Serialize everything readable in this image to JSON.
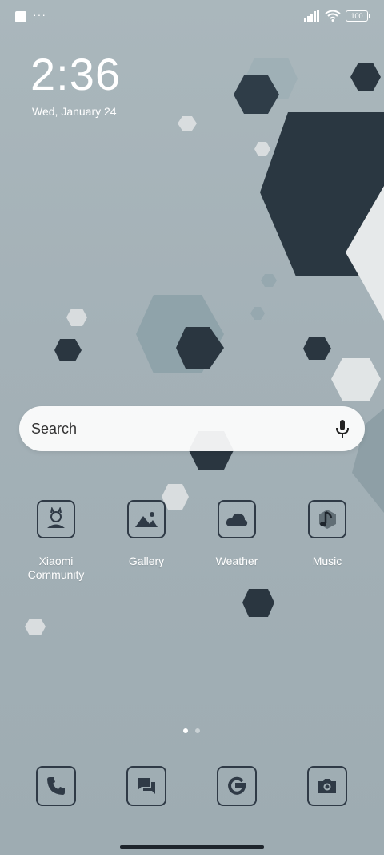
{
  "status_bar": {
    "notification_dots": "···",
    "battery_level": "100",
    "icons": [
      "app-notification-icon",
      "signal-icon",
      "wifi-icon",
      "battery-icon"
    ]
  },
  "clock": {
    "time": "2:36",
    "date": "Wed, January 24"
  },
  "search": {
    "placeholder": "Search",
    "icon": "mic-icon"
  },
  "apps": [
    {
      "label": "Xiaomi Community",
      "icon": "community-icon"
    },
    {
      "label": "Gallery",
      "icon": "gallery-icon"
    },
    {
      "label": "Weather",
      "icon": "cloud-icon"
    },
    {
      "label": "Music",
      "icon": "music-note-icon"
    }
  ],
  "page_indicator": {
    "current": 1,
    "total": 2
  },
  "dock": [
    {
      "icon": "phone-icon"
    },
    {
      "icon": "messages-icon"
    },
    {
      "icon": "google-icon"
    },
    {
      "icon": "camera-icon"
    }
  ],
  "colors": {
    "icon_stroke": "#2f3a46",
    "background": "#a4b1b7"
  }
}
